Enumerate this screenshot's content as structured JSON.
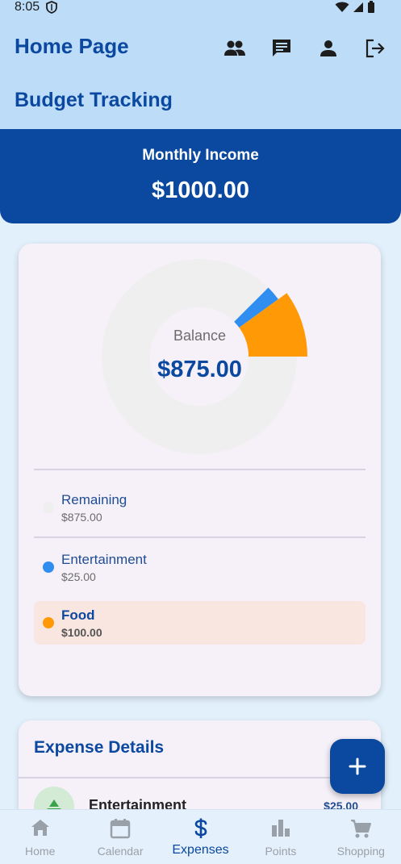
{
  "status_bar": {
    "time": "8:05"
  },
  "app_bar": {
    "title": "Home Page",
    "section_title": "Budget Tracking",
    "actions": [
      "group-icon",
      "chat-icon",
      "person-icon",
      "logout-icon"
    ]
  },
  "income": {
    "label": "Monthly Income",
    "value": "$1000.00"
  },
  "chart": {
    "center_label": "Balance",
    "center_value": "$875.00"
  },
  "chart_data": {
    "type": "pie",
    "categories": [
      "Remaining",
      "Entertainment",
      "Food"
    ],
    "values": [
      875,
      25,
      100
    ],
    "colors": [
      "#efefef",
      "#2f8ef0",
      "#ff9a06"
    ],
    "highlighted": "Food"
  },
  "legend": [
    {
      "name": "Remaining",
      "amount": "$875.00",
      "color": "#efefef"
    },
    {
      "name": "Entertainment",
      "amount": "$25.00",
      "color": "#2f8ef0"
    },
    {
      "name": "Food",
      "amount": "$100.00",
      "color": "#ff9a06"
    }
  ],
  "expense_details": {
    "title": "Expense Details",
    "items": [
      {
        "name": "Entertainment",
        "amount": "$25.00",
        "icon": "entertainment-icon"
      }
    ]
  },
  "fab": {
    "icon": "plus-icon"
  },
  "bottom_nav": {
    "items": [
      {
        "label": "Home",
        "icon": "home-icon"
      },
      {
        "label": "Calendar",
        "icon": "calendar-icon"
      },
      {
        "label": "Expenses",
        "icon": "dollar-icon"
      },
      {
        "label": "Points",
        "icon": "bar-chart-icon"
      },
      {
        "label": "Shopping",
        "icon": "cart-icon"
      }
    ],
    "active": "Expenses"
  },
  "colors": {
    "primary": "#0b48a0",
    "app_bar": "#bcdcf7",
    "background": "#e2f0fc",
    "card": "#f6f1f9"
  }
}
